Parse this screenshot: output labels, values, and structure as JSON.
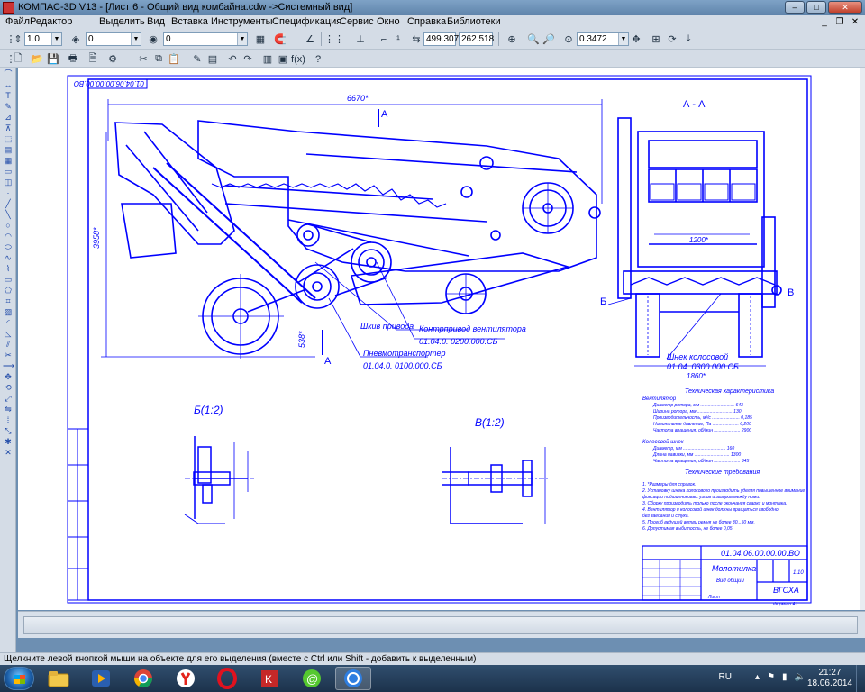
{
  "window": {
    "title": "КОМПАС-3D V13 - [Лист 6 - Общий вид комбайна.cdw ->Системный вид]",
    "minimize": "–",
    "maximize": "□",
    "close": "✕"
  },
  "menu": {
    "items": [
      "Файл",
      "Редактор",
      "Выделить",
      "Вид",
      "Вставка",
      "Инструменты",
      "Спецификация",
      "Сервис",
      "Окно",
      "Справка",
      "Библиотеки"
    ]
  },
  "toolbar": {
    "line_scale": "1.0",
    "layer": "0",
    "style": "0",
    "coord_x": "499.307",
    "coord_y": "262.518",
    "zoom": "0.3472"
  },
  "drawing": {
    "doc_number_rotated": "01.04.06.00.00.00.ВО",
    "section_title": "А - А",
    "section_a_mark": "А",
    "dim_top": "6670*",
    "dim_height": "3958*",
    "dim_bottom_left": "538*",
    "dim_section_width": "1200*",
    "dim_section_overall": "1860*",
    "callout_pulley": "Шкив привода",
    "callout_drive": "Контрпривод вентилятора",
    "callout_drive_code": "01.04.0. 0200.000.СБ",
    "callout_elevator": "Пневмотранспортер",
    "callout_elevator_code": "01.04.0. 0100.000.СБ",
    "callout_auger": "Шнек колосовой",
    "callout_auger_code": "01.04.   0300.000.СБ",
    "view_b": "Б(1:2)",
    "view_v": "В(1:2)",
    "mark_b": "Б",
    "mark_v": "В",
    "tech_title": "Техническая характеристика",
    "tech_fan": "Вентилятор",
    "tech_lines": [
      "Диаметр ротора, мм ........................... 643",
      "Ширина ротора, мм ............................ 130",
      "Производительность, м³/с ...................... 0,185",
      "Номинальное давление, Па ..................... 6,200",
      "Частота вращения, об/мин ..................... 2900"
    ],
    "tech_auger": "Колосовой шнек",
    "tech_auger_lines": [
      "Диаметр, мм .................................. 160",
      "Длина навивки, мм ............................ 1300",
      "Частота вращения, об/мин ..................... 345"
    ],
    "req_title": "Технические требования",
    "requirements": [
      "1. *Размеры для справок.",
      "2. Установку шнека колосового производить уделяя повышенное внимание",
      "   фиксации подшипниковых узлов и зазоров между ними.",
      "3. Сборку производить только после окончания сварки и монтажа.",
      "4. Вентилятор и колосовой шнек должны вращаться свободно",
      "   без заедания и стука.",
      "5. Прогиб ведущей ветви ремня не более 30...50 мм.",
      "6. Допустимая выбитость, не более 0,05"
    ],
    "stamp_code": "01.04.06.00.00.00.ВО",
    "stamp_name": "Молотилка",
    "stamp_subname": "Вид общий",
    "stamp_org": "ВГСХА",
    "stamp_scale": "1:10",
    "stamp_sheet": "Лист",
    "stamp_format": "Формат  А1"
  },
  "status": {
    "hint": "Щелкните левой кнопкой мыши на объекте для его выделения (вместе с Ctrl или Shift - добавить к выделенным)"
  },
  "taskbar": {
    "lang": "RU",
    "time": "21:27",
    "date": "18.06.2014"
  },
  "colors": {
    "drawing": "#0000ff",
    "titlebar": "#6d8fb2"
  }
}
